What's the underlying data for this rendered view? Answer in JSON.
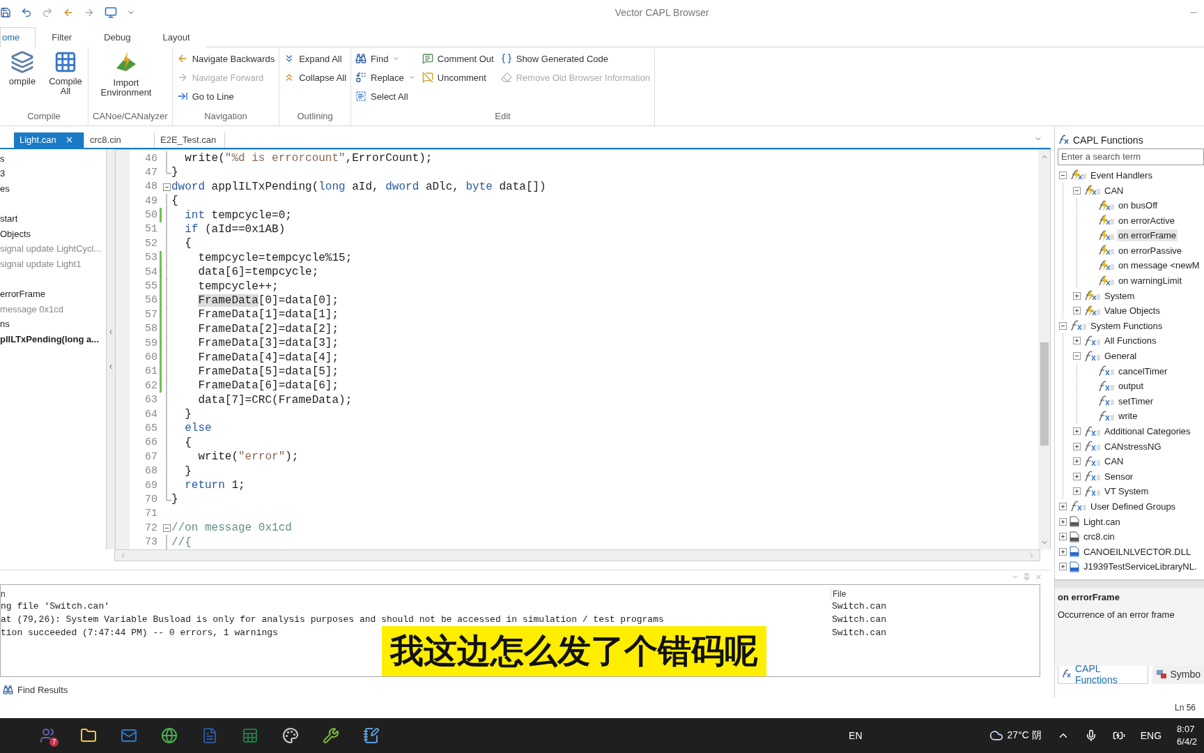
{
  "window": {
    "title": "Vector CAPL Browser"
  },
  "ribbon_tabs": [
    {
      "label": "ome",
      "selected": true
    },
    {
      "label": "Filter",
      "selected": false
    },
    {
      "label": "Debug",
      "selected": false
    },
    {
      "label": "Layout",
      "selected": false
    }
  ],
  "ribbon_groups": [
    {
      "label": "Compile",
      "columns": [
        [
          {
            "label": "ompile",
            "kind": "large",
            "disabled": false
          }
        ],
        [
          {
            "label": "Compile All",
            "kind": "large",
            "disabled": false
          }
        ]
      ]
    },
    {
      "label": "CANoe/CANalyzer",
      "columns": [
        [
          {
            "label": "Import Environment",
            "kind": "large",
            "disabled": false
          }
        ]
      ]
    },
    {
      "label": "Navigation",
      "columns": [
        [
          {
            "label": "Navigate Backwards",
            "kind": "small",
            "disabled": false
          },
          {
            "label": "Navigate Forward",
            "kind": "small",
            "disabled": true
          },
          {
            "label": "Go to Line",
            "kind": "small",
            "disabled": false
          }
        ]
      ]
    },
    {
      "label": "Outlining",
      "columns": [
        [
          {
            "label": "Expand All",
            "kind": "small",
            "disabled": false
          },
          {
            "label": "Collapse All",
            "kind": "small",
            "disabled": false
          }
        ]
      ]
    },
    {
      "label": "Edit",
      "columns": [
        [
          {
            "label": "Find",
            "kind": "small",
            "disabled": false,
            "dropdown": true
          },
          {
            "label": "Replace",
            "kind": "small",
            "disabled": false,
            "dropdown": true
          },
          {
            "label": "Select All",
            "kind": "small",
            "disabled": false
          }
        ],
        [
          {
            "label": "Comment Out",
            "kind": "small",
            "disabled": false
          },
          {
            "label": "Uncomment",
            "kind": "small",
            "disabled": false
          }
        ],
        [
          {
            "label": "Show Generated Code",
            "kind": "small",
            "disabled": false
          },
          {
            "label": "Remove Old Browser Information",
            "kind": "small",
            "disabled": true
          }
        ]
      ]
    }
  ],
  "doc_tabs": [
    {
      "label": "Light.can",
      "selected": true
    },
    {
      "label": "crc8.cin",
      "selected": false
    },
    {
      "label": "E2E_Test.can",
      "selected": false
    }
  ],
  "outline": [
    {
      "label": "s",
      "dim": false,
      "selected": false
    },
    {
      "label": "3",
      "dim": false,
      "selected": false
    },
    {
      "label": "es",
      "dim": false,
      "selected": false
    },
    {
      "label": "start",
      "dim": false,
      "selected": false,
      "spacer_before": true
    },
    {
      "label": "Objects",
      "dim": false,
      "selected": false
    },
    {
      "label": "signal update LightCycl...",
      "dim": true,
      "selected": false
    },
    {
      "label": "signal update Light1",
      "dim": true,
      "selected": false
    },
    {
      "label": "errorFrame",
      "dim": false,
      "selected": false,
      "spacer_before": true
    },
    {
      "label": "message 0x1cd",
      "dim": true,
      "selected": false
    },
    {
      "label": "ns",
      "dim": false,
      "selected": false
    },
    {
      "label": "plILTxPending(long a...",
      "dim": false,
      "selected": true
    }
  ],
  "code": [
    {
      "n": "46",
      "kind": "body",
      "modified": false,
      "segs": [
        {
          "text": "  write(",
          "kind": "plain"
        },
        {
          "text": "\"%d is errorcount\"",
          "kind": "string"
        },
        {
          "text": ",ErrorCount);",
          "kind": "plain"
        }
      ]
    },
    {
      "n": "47",
      "kind": "end",
      "modified": false,
      "segs": [
        {
          "text": "}",
          "kind": "plain"
        }
      ]
    },
    {
      "n": "48",
      "kind": "start",
      "modified": false,
      "segs": [
        {
          "text": "dword",
          "kind": "keyword"
        },
        {
          "text": " applILTxPending(",
          "kind": "plain"
        },
        {
          "text": "long",
          "kind": "keyword"
        },
        {
          "text": " aId, ",
          "kind": "plain"
        },
        {
          "text": "dword",
          "kind": "keyword"
        },
        {
          "text": " aDlc, ",
          "kind": "plain"
        },
        {
          "text": "byte",
          "kind": "keyword"
        },
        {
          "text": " data[])",
          "kind": "plain"
        }
      ]
    },
    {
      "n": "49",
      "kind": "body",
      "modified": false,
      "segs": [
        {
          "text": "{",
          "kind": "plain"
        }
      ]
    },
    {
      "n": "50",
      "kind": "body",
      "modified": true,
      "segs": [
        {
          "text": "  int",
          "kind": "keyword"
        },
        {
          "text": " tempcycle=0;",
          "kind": "plain"
        }
      ]
    },
    {
      "n": "51",
      "kind": "body",
      "modified": false,
      "segs": [
        {
          "text": "  if",
          "kind": "keyword"
        },
        {
          "text": " (aId==0x1AB)",
          "kind": "plain"
        }
      ]
    },
    {
      "n": "52",
      "kind": "body",
      "modified": false,
      "segs": [
        {
          "text": "  {",
          "kind": "plain"
        }
      ]
    },
    {
      "n": "53",
      "kind": "body",
      "modified": true,
      "segs": [
        {
          "text": "    tempcycle=tempcycle%15;",
          "kind": "plain"
        }
      ]
    },
    {
      "n": "54",
      "kind": "body",
      "modified": true,
      "segs": [
        {
          "text": "    data[6]=tempcycle;",
          "kind": "plain"
        }
      ]
    },
    {
      "n": "55",
      "kind": "body",
      "modified": true,
      "segs": [
        {
          "text": "    tempcycle++;",
          "kind": "plain"
        }
      ]
    },
    {
      "n": "56",
      "kind": "body",
      "modified": true,
      "segs": [
        {
          "text": "    FrameData",
          "kind": "highlight"
        },
        {
          "text": "[0]=data[0];",
          "kind": "plain"
        }
      ]
    },
    {
      "n": "57",
      "kind": "body",
      "modified": true,
      "segs": [
        {
          "text": "    FrameData[1]=data[1];",
          "kind": "plain"
        }
      ]
    },
    {
      "n": "58",
      "kind": "body",
      "modified": true,
      "segs": [
        {
          "text": "    FrameData[2]=data[2];",
          "kind": "plain"
        }
      ]
    },
    {
      "n": "59",
      "kind": "body",
      "modified": true,
      "segs": [
        {
          "text": "    FrameData[3]=data[3];",
          "kind": "plain"
        }
      ]
    },
    {
      "n": "60",
      "kind": "body",
      "modified": true,
      "segs": [
        {
          "text": "    FrameData[4]=data[4];",
          "kind": "plain"
        }
      ]
    },
    {
      "n": "61",
      "kind": "body",
      "modified": true,
      "segs": [
        {
          "text": "    FrameData[5]=data[5];",
          "kind": "plain"
        }
      ]
    },
    {
      "n": "62",
      "kind": "body",
      "modified": true,
      "segs": [
        {
          "text": "    FrameData[6]=data[6];",
          "kind": "plain"
        }
      ]
    },
    {
      "n": "63",
      "kind": "body",
      "modified": false,
      "segs": [
        {
          "text": "    data[7]=CRC(FrameData);",
          "kind": "plain"
        }
      ]
    },
    {
      "n": "64",
      "kind": "body",
      "modified": false,
      "segs": [
        {
          "text": "  }",
          "kind": "plain"
        }
      ]
    },
    {
      "n": "65",
      "kind": "body",
      "modified": false,
      "segs": [
        {
          "text": "  else",
          "kind": "keyword"
        }
      ]
    },
    {
      "n": "66",
      "kind": "body",
      "modified": false,
      "segs": [
        {
          "text": "  {",
          "kind": "plain"
        }
      ]
    },
    {
      "n": "67",
      "kind": "body",
      "modified": false,
      "segs": [
        {
          "text": "    write(",
          "kind": "plain"
        },
        {
          "text": "\"error\"",
          "kind": "string"
        },
        {
          "text": ");",
          "kind": "plain"
        }
      ]
    },
    {
      "n": "68",
      "kind": "body",
      "modified": false,
      "segs": [
        {
          "text": "  }",
          "kind": "plain"
        }
      ]
    },
    {
      "n": "69",
      "kind": "body",
      "modified": false,
      "segs": [
        {
          "text": "  return",
          "kind": "keyword"
        },
        {
          "text": " 1;",
          "kind": "plain"
        }
      ]
    },
    {
      "n": "70",
      "kind": "end",
      "modified": false,
      "segs": [
        {
          "text": "}",
          "kind": "plain"
        }
      ]
    },
    {
      "n": "71",
      "kind": "blank",
      "modified": false
    },
    {
      "n": "72",
      "kind": "start",
      "modified": false,
      "segs": [
        {
          "text": "//on message 0x1cd",
          "kind": "comment"
        }
      ]
    },
    {
      "n": "73",
      "kind": "body",
      "modified": false,
      "segs": [
        {
          "text": "//{",
          "kind": "comment"
        }
      ]
    }
  ],
  "output": {
    "columns": [
      "n",
      "File"
    ],
    "rows": [
      {
        "message": "ng file 'Switch.can'",
        "file": "Switch.can"
      },
      {
        "message": "at (79,26): System Variable Busload is only for analysis purposes and should not be accessed in simulation / test programs",
        "file": "Switch.can"
      },
      {
        "message": "tion succeeded (7:47:44 PM) -- 0 errors, 1 warnings",
        "file": "Switch.can"
      }
    ]
  },
  "bottom_tabs": [
    {
      "label": "Find Results"
    }
  ],
  "capl_panel": {
    "title": "CAPL Functions",
    "search": {
      "placeholder": "Enter a search term"
    },
    "tree": [
      {
        "label": "Event Handlers",
        "kind": "event",
        "expanded": true,
        "selected": false,
        "children": [
          {
            "label": "CAN",
            "kind": "event",
            "expanded": true,
            "selected": false,
            "children": [
              {
                "label": "on busOff",
                "kind": "event",
                "selected": false
              },
              {
                "label": "on errorActive",
                "kind": "event",
                "selected": false
              },
              {
                "label": "on errorFrame",
                "kind": "event",
                "selected": true
              },
              {
                "label": "on errorPassive",
                "kind": "event",
                "selected": false
              },
              {
                "label": "on message <newM",
                "kind": "event",
                "selected": false
              },
              {
                "label": "on warningLimit",
                "kind": "event",
                "selected": false
              }
            ]
          },
          {
            "label": "System",
            "kind": "event",
            "expanded": false,
            "selected": false
          },
          {
            "label": "Value Objects",
            "kind": "event",
            "expanded": false,
            "selected": false
          }
        ]
      },
      {
        "label": "System Functions",
        "kind": "function",
        "expanded": true,
        "selected": false,
        "children": [
          {
            "label": "All Functions",
            "kind": "function",
            "expanded": false,
            "selected": false
          },
          {
            "label": "General",
            "kind": "function",
            "expanded": true,
            "selected": false,
            "children": [
              {
                "label": "cancelTimer",
                "kind": "function",
                "selected": false
              },
              {
                "label": "output",
                "kind": "function",
                "selected": false
              },
              {
                "label": "setTimer",
                "kind": "function",
                "selected": false
              },
              {
                "label": "write",
                "kind": "function",
                "selected": false
              }
            ]
          },
          {
            "label": "Additional Categories",
            "kind": "function",
            "expanded": false,
            "selected": false
          },
          {
            "label": "CANstressNG",
            "kind": "function",
            "expanded": false,
            "selected": false
          },
          {
            "label": "CAN",
            "kind": "function",
            "expanded": false,
            "selected": false
          },
          {
            "label": "Sensor",
            "kind": "function",
            "expanded": false,
            "selected": false
          },
          {
            "label": "VT System",
            "kind": "function",
            "expanded": false,
            "selected": false
          }
        ]
      },
      {
        "label": "User Defined Groups",
        "kind": "function",
        "expanded": false,
        "selected": false
      },
      {
        "label": "Light.can",
        "kind": "file",
        "expanded": false,
        "selected": false
      },
      {
        "label": "crc8.cin",
        "kind": "file",
        "expanded": false,
        "selected": false
      },
      {
        "label": "CANOEILNLVECTOR.DLL",
        "kind": "library",
        "expanded": false,
        "selected": false
      },
      {
        "label": "J1939TestServiceLibraryNL.",
        "kind": "library",
        "expanded": false,
        "selected": false
      }
    ],
    "description": {
      "title": "on errorFrame",
      "text": "Occurrence of an error frame"
    },
    "tabs": [
      {
        "label": "CAPL Functions",
        "selected": true
      },
      {
        "label": "Symbo",
        "selected": false
      }
    ]
  },
  "status_bar": {
    "position": "Ln 56"
  },
  "subtitle": "我这边怎么发了个错码呢",
  "taskbar": {
    "apps": [
      {
        "kind": "teams",
        "badge": "7"
      },
      {
        "kind": "folder"
      },
      {
        "kind": "mail"
      },
      {
        "kind": "browser"
      },
      {
        "kind": "word"
      },
      {
        "kind": "excel"
      },
      {
        "kind": "paint"
      },
      {
        "kind": "tool"
      },
      {
        "kind": "notepad"
      }
    ],
    "language_bar": "EN",
    "weather": "27°C 阴",
    "input_lang": "ENG",
    "time": "8:07",
    "date": "6/4/2"
  }
}
